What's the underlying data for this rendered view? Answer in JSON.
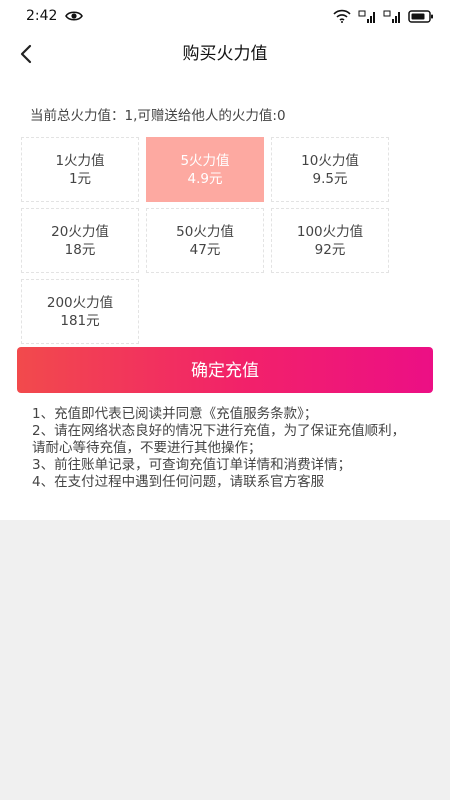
{
  "status_bar": {
    "time": "2:42",
    "icons": [
      "eye-icon",
      "wifi-icon",
      "signal-icon-1",
      "signal-icon-2",
      "battery-icon"
    ]
  },
  "nav": {
    "back_icon": "chevron-left-icon",
    "title": "购买火力值"
  },
  "summary": {
    "total_label": "当前总火力值：",
    "total_value": "1",
    "gift_label": ",可赠送给他人的火力值:",
    "gift_value": "0"
  },
  "options": [
    {
      "amount": "1火力值",
      "price": "1元",
      "selected": false
    },
    {
      "amount": "5火力值",
      "price": "4.9元",
      "selected": true
    },
    {
      "amount": "10火力值",
      "price": "9.5元",
      "selected": false
    },
    {
      "amount": "20火力值",
      "price": "18元",
      "selected": false
    },
    {
      "amount": "50火力值",
      "price": "47元",
      "selected": false
    },
    {
      "amount": "100火力值",
      "price": "92元",
      "selected": false
    },
    {
      "amount": "200火力值",
      "price": "181元",
      "selected": false
    }
  ],
  "confirm_label": "确定充值",
  "notes": [
    "1、充值即代表已阅读并同意《充值服务条款》；",
    "2、请在网络状态良好的情况下进行充值，为了保证充值顺利，请耐心等待充值，不要进行其他操作；",
    "3、前往账单记录，可查询充值订单详情和消费详情；",
    "4、在支付过程中遇到任何问题，请联系官方客服"
  ],
  "colors": {
    "selected_option": "#fda9a1",
    "button_gradient_start": "#f24a4c",
    "button_gradient_end": "#ec0f85"
  }
}
